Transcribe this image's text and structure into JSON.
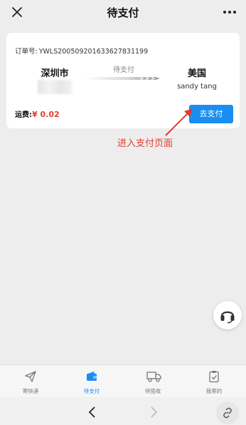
{
  "header": {
    "title": "待支付",
    "close_icon": "close-icon",
    "more_icon": "more-icon"
  },
  "order": {
    "order_no_label": "订单号:",
    "order_no": "YWLS200509201633627831199",
    "origin": "深圳市",
    "status": "待支付",
    "destination": "美国",
    "recipient": "sandy tang",
    "fee_label": "运费:",
    "fee_amount": "¥ 0.02",
    "pay_button": "去支付"
  },
  "annotation": {
    "text": "进入支付页面",
    "color": "#e23b2f"
  },
  "tabbar": {
    "tabs": [
      {
        "label": "寄快递",
        "icon": "send-icon",
        "active": false
      },
      {
        "label": "待支付",
        "icon": "wallet-icon",
        "active": true
      },
      {
        "label": "待揽收",
        "icon": "truck-icon",
        "active": false
      },
      {
        "label": "我寄的",
        "icon": "checklist-icon",
        "active": false
      }
    ]
  },
  "colors": {
    "accent": "#1a8ef0",
    "price": "#e03b2f",
    "background": "#ededed"
  }
}
